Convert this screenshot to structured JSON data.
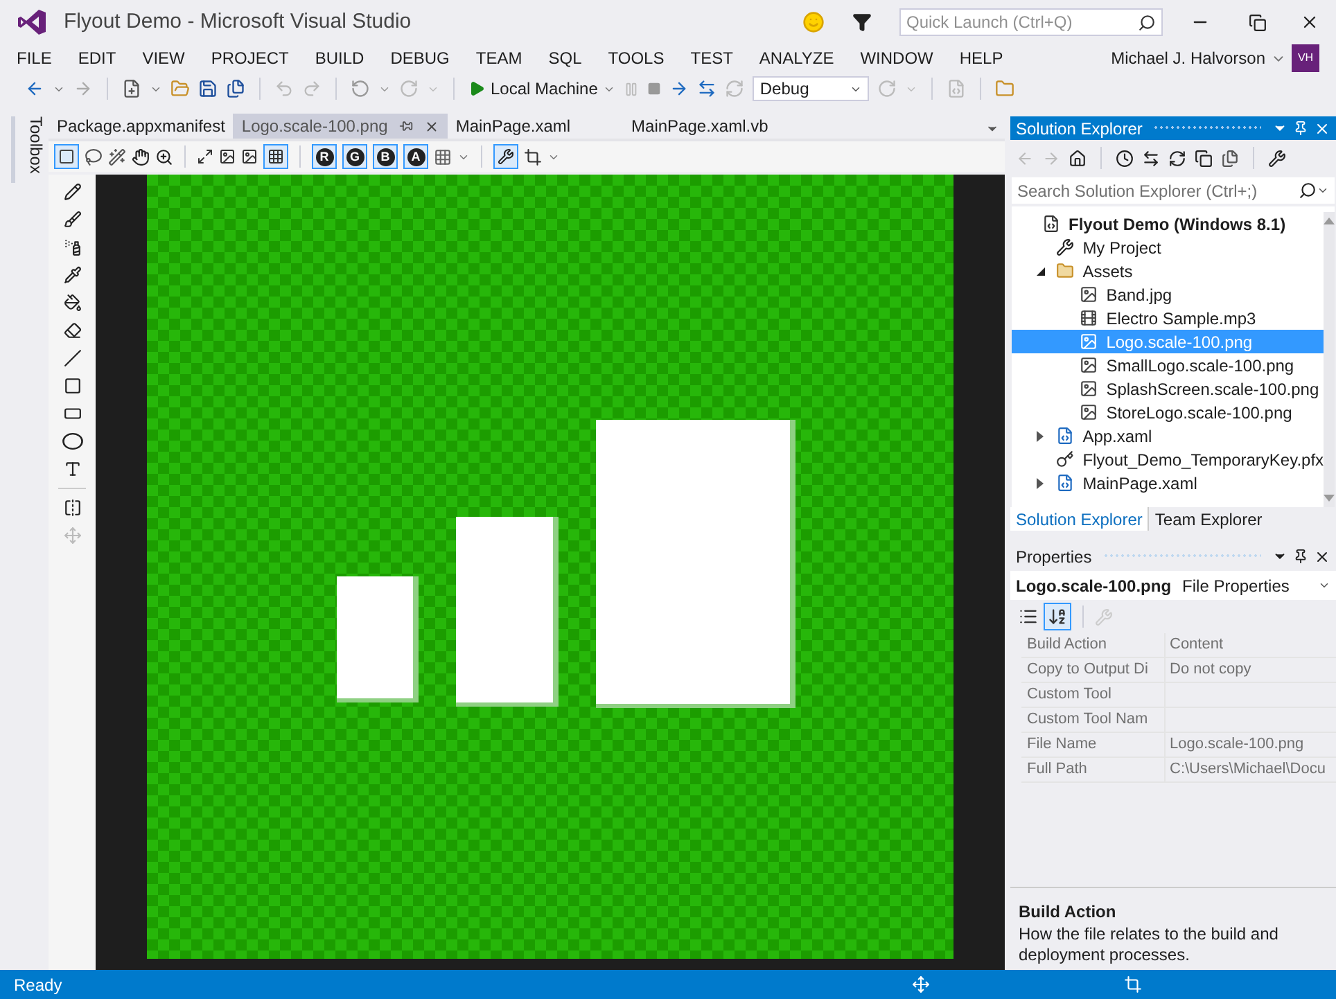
{
  "window": {
    "title": "Flyout Demo - Microsoft Visual Studio",
    "quick_launch": {
      "placeholder": "Quick Launch (Ctrl+Q)"
    }
  },
  "menu": [
    "FILE",
    "EDIT",
    "VIEW",
    "PROJECT",
    "BUILD",
    "DEBUG",
    "TEAM",
    "SQL",
    "TOOLS",
    "TEST",
    "ANALYZE",
    "WINDOW",
    "HELP"
  ],
  "user": {
    "name": "Michael J. Halvorson",
    "initials": "VH"
  },
  "toolbar": {
    "run_target": "Local Machine",
    "configuration": "Debug"
  },
  "toolbox": {
    "label": "Toolbox"
  },
  "tabs": [
    {
      "label": "Package.appxmanifest",
      "selected": false
    },
    {
      "label": "Logo.scale-100.png",
      "selected": true
    },
    {
      "label": "MainPage.xaml",
      "selected": false
    },
    {
      "label": "MainPage.xaml.vb",
      "selected": false
    }
  ],
  "channels": [
    {
      "label": "R",
      "selected": true
    },
    {
      "label": "G",
      "selected": true
    },
    {
      "label": "B",
      "selected": true
    },
    {
      "label": "A",
      "selected": true
    }
  ],
  "solution_explorer": {
    "title": "Solution Explorer",
    "search": {
      "placeholder": "Search Solution Explorer (Ctrl+;)"
    },
    "tree": [
      {
        "label": "Flyout Demo (Windows 8.1)",
        "kind": "solution",
        "selected": false,
        "children": [
          {
            "label": "My Project",
            "kind": "settings",
            "selected": false
          },
          {
            "label": "Assets",
            "kind": "folder",
            "expanded": true,
            "selected": false,
            "children": [
              {
                "label": "Band.jpg",
                "kind": "image",
                "selected": false
              },
              {
                "label": "Electro Sample.mp3",
                "kind": "media",
                "selected": false
              },
              {
                "label": "Logo.scale-100.png",
                "kind": "image",
                "selected": true
              },
              {
                "label": "SmallLogo.scale-100.png",
                "kind": "image",
                "selected": false
              },
              {
                "label": "SplashScreen.scale-100.png",
                "kind": "image",
                "selected": false
              },
              {
                "label": "StoreLogo.scale-100.png",
                "kind": "image",
                "selected": false
              }
            ]
          },
          {
            "label": "App.xaml",
            "kind": "xaml",
            "expanded": false,
            "selected": false
          },
          {
            "label": "Flyout_Demo_TemporaryKey.pfx",
            "kind": "key",
            "selected": false
          },
          {
            "label": "MainPage.xaml",
            "kind": "xaml",
            "expanded": false,
            "selected": false
          }
        ]
      }
    ],
    "tabs": [
      {
        "label": "Solution Explorer",
        "selected": true
      },
      {
        "label": "Team Explorer",
        "selected": false
      }
    ]
  },
  "properties": {
    "title": "Properties",
    "object": "Logo.scale-100.png",
    "object_type": "File Properties",
    "rows": [
      {
        "name": "Build Action",
        "value": "Content"
      },
      {
        "name": "Copy to Output Di",
        "value": "Do not copy"
      },
      {
        "name": "Custom Tool"
      },
      {
        "name": "Custom Tool Nam"
      },
      {
        "name": "File Name",
        "value": "Logo.scale-100.png"
      },
      {
        "name": "Full Path",
        "value": "C:\\Users\\Michael\\Docu"
      }
    ],
    "description": {
      "title": "Build Action",
      "text": "How the file relates to the build and deployment processes."
    }
  },
  "status_bar": {
    "text": "Ready"
  }
}
